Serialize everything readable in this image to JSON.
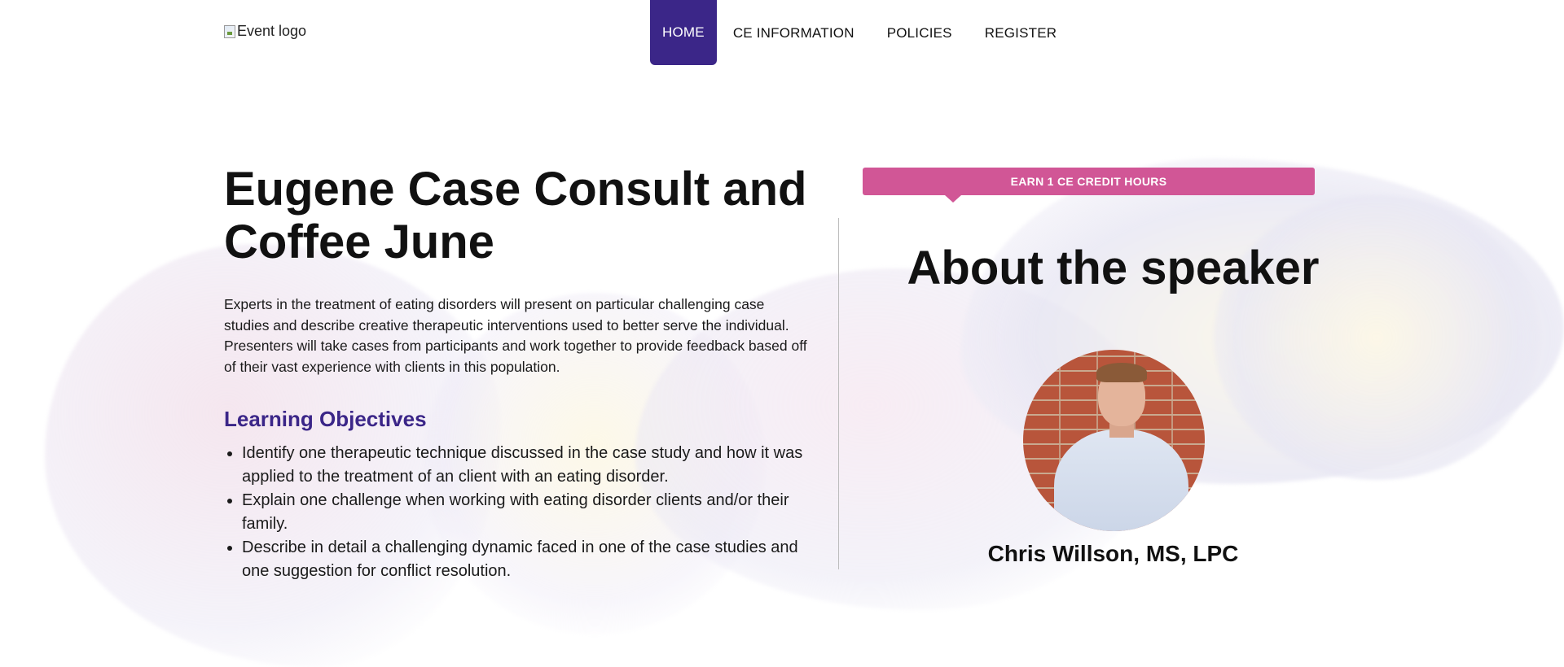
{
  "header": {
    "logo_alt": "Event logo",
    "nav": [
      {
        "label": "HOME",
        "active": true
      },
      {
        "label": "CE INFORMATION",
        "active": false
      },
      {
        "label": "POLICIES",
        "active": false
      },
      {
        "label": "REGISTER",
        "active": false
      }
    ]
  },
  "main": {
    "title": "Eugene Case Consult and Coffee June",
    "intro": "Experts in the treatment of eating disorders will present on particular challenging case studies and describe creative therapeutic interventions used to better serve the individual. Presenters will take cases from participants and work together to provide feedback based off of their vast experience with clients in this population.",
    "objectives_heading": "Learning Objectives",
    "objectives": [
      "Identify one therapeutic technique discussed in the case study and how it was applied to the treatment of an client with an eating disorder.",
      "Explain one challenge when working with eating disorder clients and/or their family.",
      "Describe in detail a challenging dynamic faced in one of the case studies and one suggestion for conflict resolution."
    ]
  },
  "sidebar": {
    "banner": "EARN 1 CE CREDIT HOURS",
    "about_heading": "About the speaker",
    "speaker_name": "Chris Willson, MS, LPC"
  },
  "colors": {
    "accent_purple": "#3b2688",
    "banner_pink": "#d15696"
  }
}
